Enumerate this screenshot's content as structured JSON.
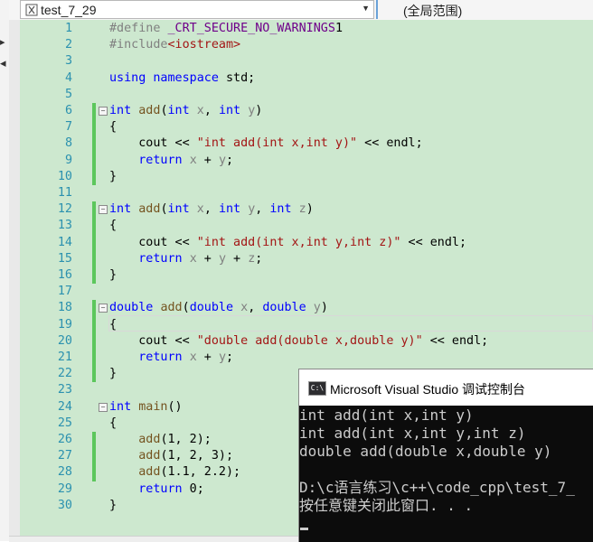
{
  "navbar": {
    "file_name": "test_7_29",
    "scope": "(全局范围)"
  },
  "editor": {
    "lines": [
      {
        "n": "1",
        "t": [
          [
            "pp",
            "#define "
          ],
          [
            "mac",
            "_CRT_SECURE_NO_WARNINGS"
          ],
          [
            "",
            "1"
          ]
        ]
      },
      {
        "n": "2",
        "t": [
          [
            "pp",
            "#include"
          ],
          [
            "str",
            "<iostream>"
          ]
        ]
      },
      {
        "n": "3",
        "t": []
      },
      {
        "n": "4",
        "t": [
          [
            "kw",
            "using namespace"
          ],
          [
            "",
            " std;"
          ]
        ]
      },
      {
        "n": "5",
        "t": []
      },
      {
        "n": "6",
        "t": [
          [
            "kw",
            "int"
          ],
          [
            "",
            " "
          ],
          [
            "fn",
            "add"
          ],
          [
            "",
            "("
          ],
          [
            "kw",
            "int"
          ],
          [
            "",
            " "
          ],
          [
            "par",
            "x"
          ],
          [
            "",
            ", "
          ],
          [
            "kw",
            "int"
          ],
          [
            "",
            " "
          ],
          [
            "par",
            "y"
          ],
          [
            "",
            ")"
          ]
        ]
      },
      {
        "n": "7",
        "t": [
          [
            "",
            "{"
          ]
        ]
      },
      {
        "n": "8",
        "t": [
          [
            "",
            "    cout << "
          ],
          [
            "str",
            "\"int add(int x,int y)\""
          ],
          [
            "",
            " << endl;"
          ]
        ]
      },
      {
        "n": "9",
        "t": [
          [
            "",
            "    "
          ],
          [
            "kw",
            "return"
          ],
          [
            "",
            " "
          ],
          [
            "par",
            "x"
          ],
          [
            "",
            " + "
          ],
          [
            "par",
            "y"
          ],
          [
            "",
            ";"
          ]
        ]
      },
      {
        "n": "10",
        "t": [
          [
            "",
            "}"
          ]
        ]
      },
      {
        "n": "11",
        "t": []
      },
      {
        "n": "12",
        "t": [
          [
            "kw",
            "int"
          ],
          [
            "",
            " "
          ],
          [
            "fn",
            "add"
          ],
          [
            "",
            "("
          ],
          [
            "kw",
            "int"
          ],
          [
            "",
            " "
          ],
          [
            "par",
            "x"
          ],
          [
            "",
            ", "
          ],
          [
            "kw",
            "int"
          ],
          [
            "",
            " "
          ],
          [
            "par",
            "y"
          ],
          [
            "",
            ", "
          ],
          [
            "kw",
            "int"
          ],
          [
            "",
            " "
          ],
          [
            "par",
            "z"
          ],
          [
            "",
            ")"
          ]
        ]
      },
      {
        "n": "13",
        "t": [
          [
            "",
            "{"
          ]
        ]
      },
      {
        "n": "14",
        "t": [
          [
            "",
            "    cout << "
          ],
          [
            "str",
            "\"int add(int x,int y,int z)\""
          ],
          [
            "",
            " << endl;"
          ]
        ]
      },
      {
        "n": "15",
        "t": [
          [
            "",
            "    "
          ],
          [
            "kw",
            "return"
          ],
          [
            "",
            " "
          ],
          [
            "par",
            "x"
          ],
          [
            "",
            " + "
          ],
          [
            "par",
            "y"
          ],
          [
            "",
            " + "
          ],
          [
            "par",
            "z"
          ],
          [
            "",
            ";"
          ]
        ]
      },
      {
        "n": "16",
        "t": [
          [
            "",
            "}"
          ]
        ]
      },
      {
        "n": "17",
        "t": []
      },
      {
        "n": "18",
        "t": [
          [
            "kw",
            "double"
          ],
          [
            "",
            " "
          ],
          [
            "fn",
            "add"
          ],
          [
            "",
            "("
          ],
          [
            "kw",
            "double"
          ],
          [
            "",
            " "
          ],
          [
            "par",
            "x"
          ],
          [
            "",
            ", "
          ],
          [
            "kw",
            "double"
          ],
          [
            "",
            " "
          ],
          [
            "par",
            "y"
          ],
          [
            "",
            ")"
          ]
        ]
      },
      {
        "n": "19",
        "t": [
          [
            "",
            "{"
          ]
        ]
      },
      {
        "n": "20",
        "t": [
          [
            "",
            "    cout << "
          ],
          [
            "str",
            "\"double add(double x,double y)\""
          ],
          [
            "",
            " << endl;"
          ]
        ]
      },
      {
        "n": "21",
        "t": [
          [
            "",
            "    "
          ],
          [
            "kw",
            "return"
          ],
          [
            "",
            " "
          ],
          [
            "par",
            "x"
          ],
          [
            "",
            " + "
          ],
          [
            "par",
            "y"
          ],
          [
            "",
            ";"
          ]
        ]
      },
      {
        "n": "22",
        "t": [
          [
            "",
            "}"
          ]
        ]
      },
      {
        "n": "23",
        "t": []
      },
      {
        "n": "24",
        "t": [
          [
            "kw",
            "int"
          ],
          [
            "",
            " "
          ],
          [
            "fn",
            "main"
          ],
          [
            "",
            "()"
          ]
        ]
      },
      {
        "n": "25",
        "t": [
          [
            "",
            "{"
          ]
        ]
      },
      {
        "n": "26",
        "t": [
          [
            "",
            "    "
          ],
          [
            "fn",
            "add"
          ],
          [
            "",
            "(1, 2);"
          ]
        ]
      },
      {
        "n": "27",
        "t": [
          [
            "",
            "    "
          ],
          [
            "fn",
            "add"
          ],
          [
            "",
            "(1, 2, 3);"
          ]
        ]
      },
      {
        "n": "28",
        "t": [
          [
            "",
            "    "
          ],
          [
            "fn",
            "add"
          ],
          [
            "",
            "(1.1, 2.2);"
          ]
        ]
      },
      {
        "n": "29",
        "t": [
          [
            "",
            "    "
          ],
          [
            "kw",
            "return"
          ],
          [
            "",
            " 0;"
          ]
        ]
      },
      {
        "n": "30",
        "t": [
          [
            "",
            "}"
          ]
        ]
      }
    ]
  },
  "console": {
    "icon_label": "C:\\",
    "title": "Microsoft Visual Studio 调试控制台",
    "lines": [
      "int add(int x,int y)",
      "int add(int x,int y,int z)",
      "double add(double x,double y)",
      "",
      "D:\\c语言练习\\c++\\code_cpp\\test_7_",
      "按任意键关闭此窗口. . ."
    ]
  }
}
